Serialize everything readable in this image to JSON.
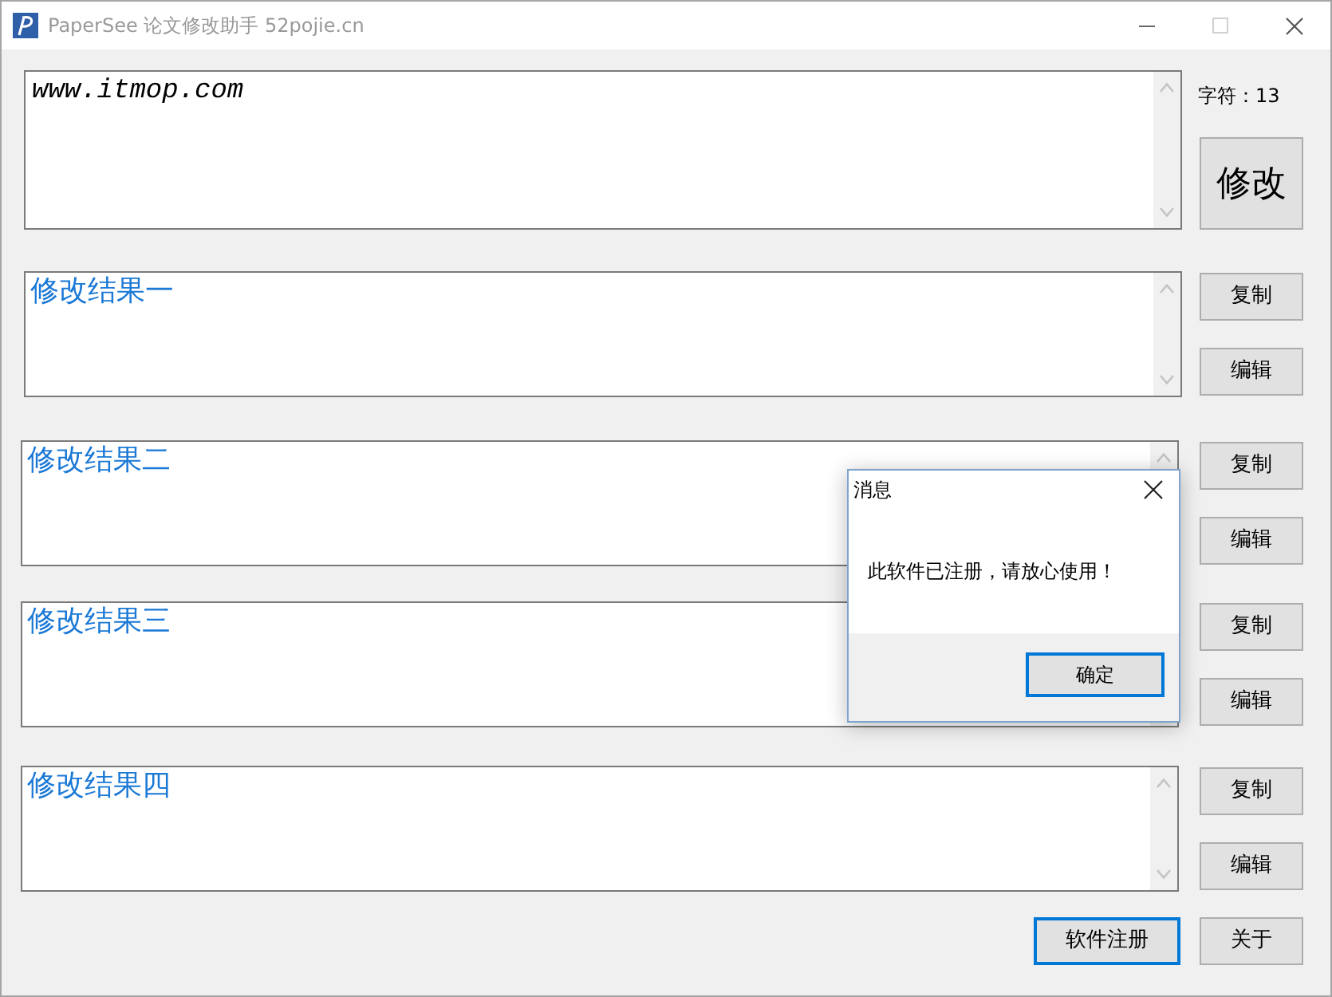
{
  "window": {
    "title": "PaperSee 论文修改助手 52pojie.cn",
    "active": false,
    "maximize_disabled": true
  },
  "source": {
    "value": "www.itmop.com",
    "char_count": "字符：13",
    "button": "修改"
  },
  "results": [
    {
      "value": "修改结果一",
      "buttons": [
        "复制",
        "编辑"
      ]
    },
    {
      "value": "修改结果二",
      "buttons": [
        "复制",
        "编辑"
      ]
    },
    {
      "value": "修改结果三",
      "buttons": [
        "复制",
        "编辑"
      ]
    },
    {
      "value": "修改结果四",
      "buttons": [
        "复制",
        "编辑"
      ]
    }
  ],
  "footer": {
    "buttons": [
      {
        "label": "软件注册",
        "focused": true
      },
      {
        "label": "关于",
        "focused": false
      }
    ]
  },
  "dialog": {
    "title": "消息",
    "message": "此软件已注册，请放心使用！",
    "buttons": [
      {
        "label": "确定",
        "focused": true
      }
    ]
  }
}
